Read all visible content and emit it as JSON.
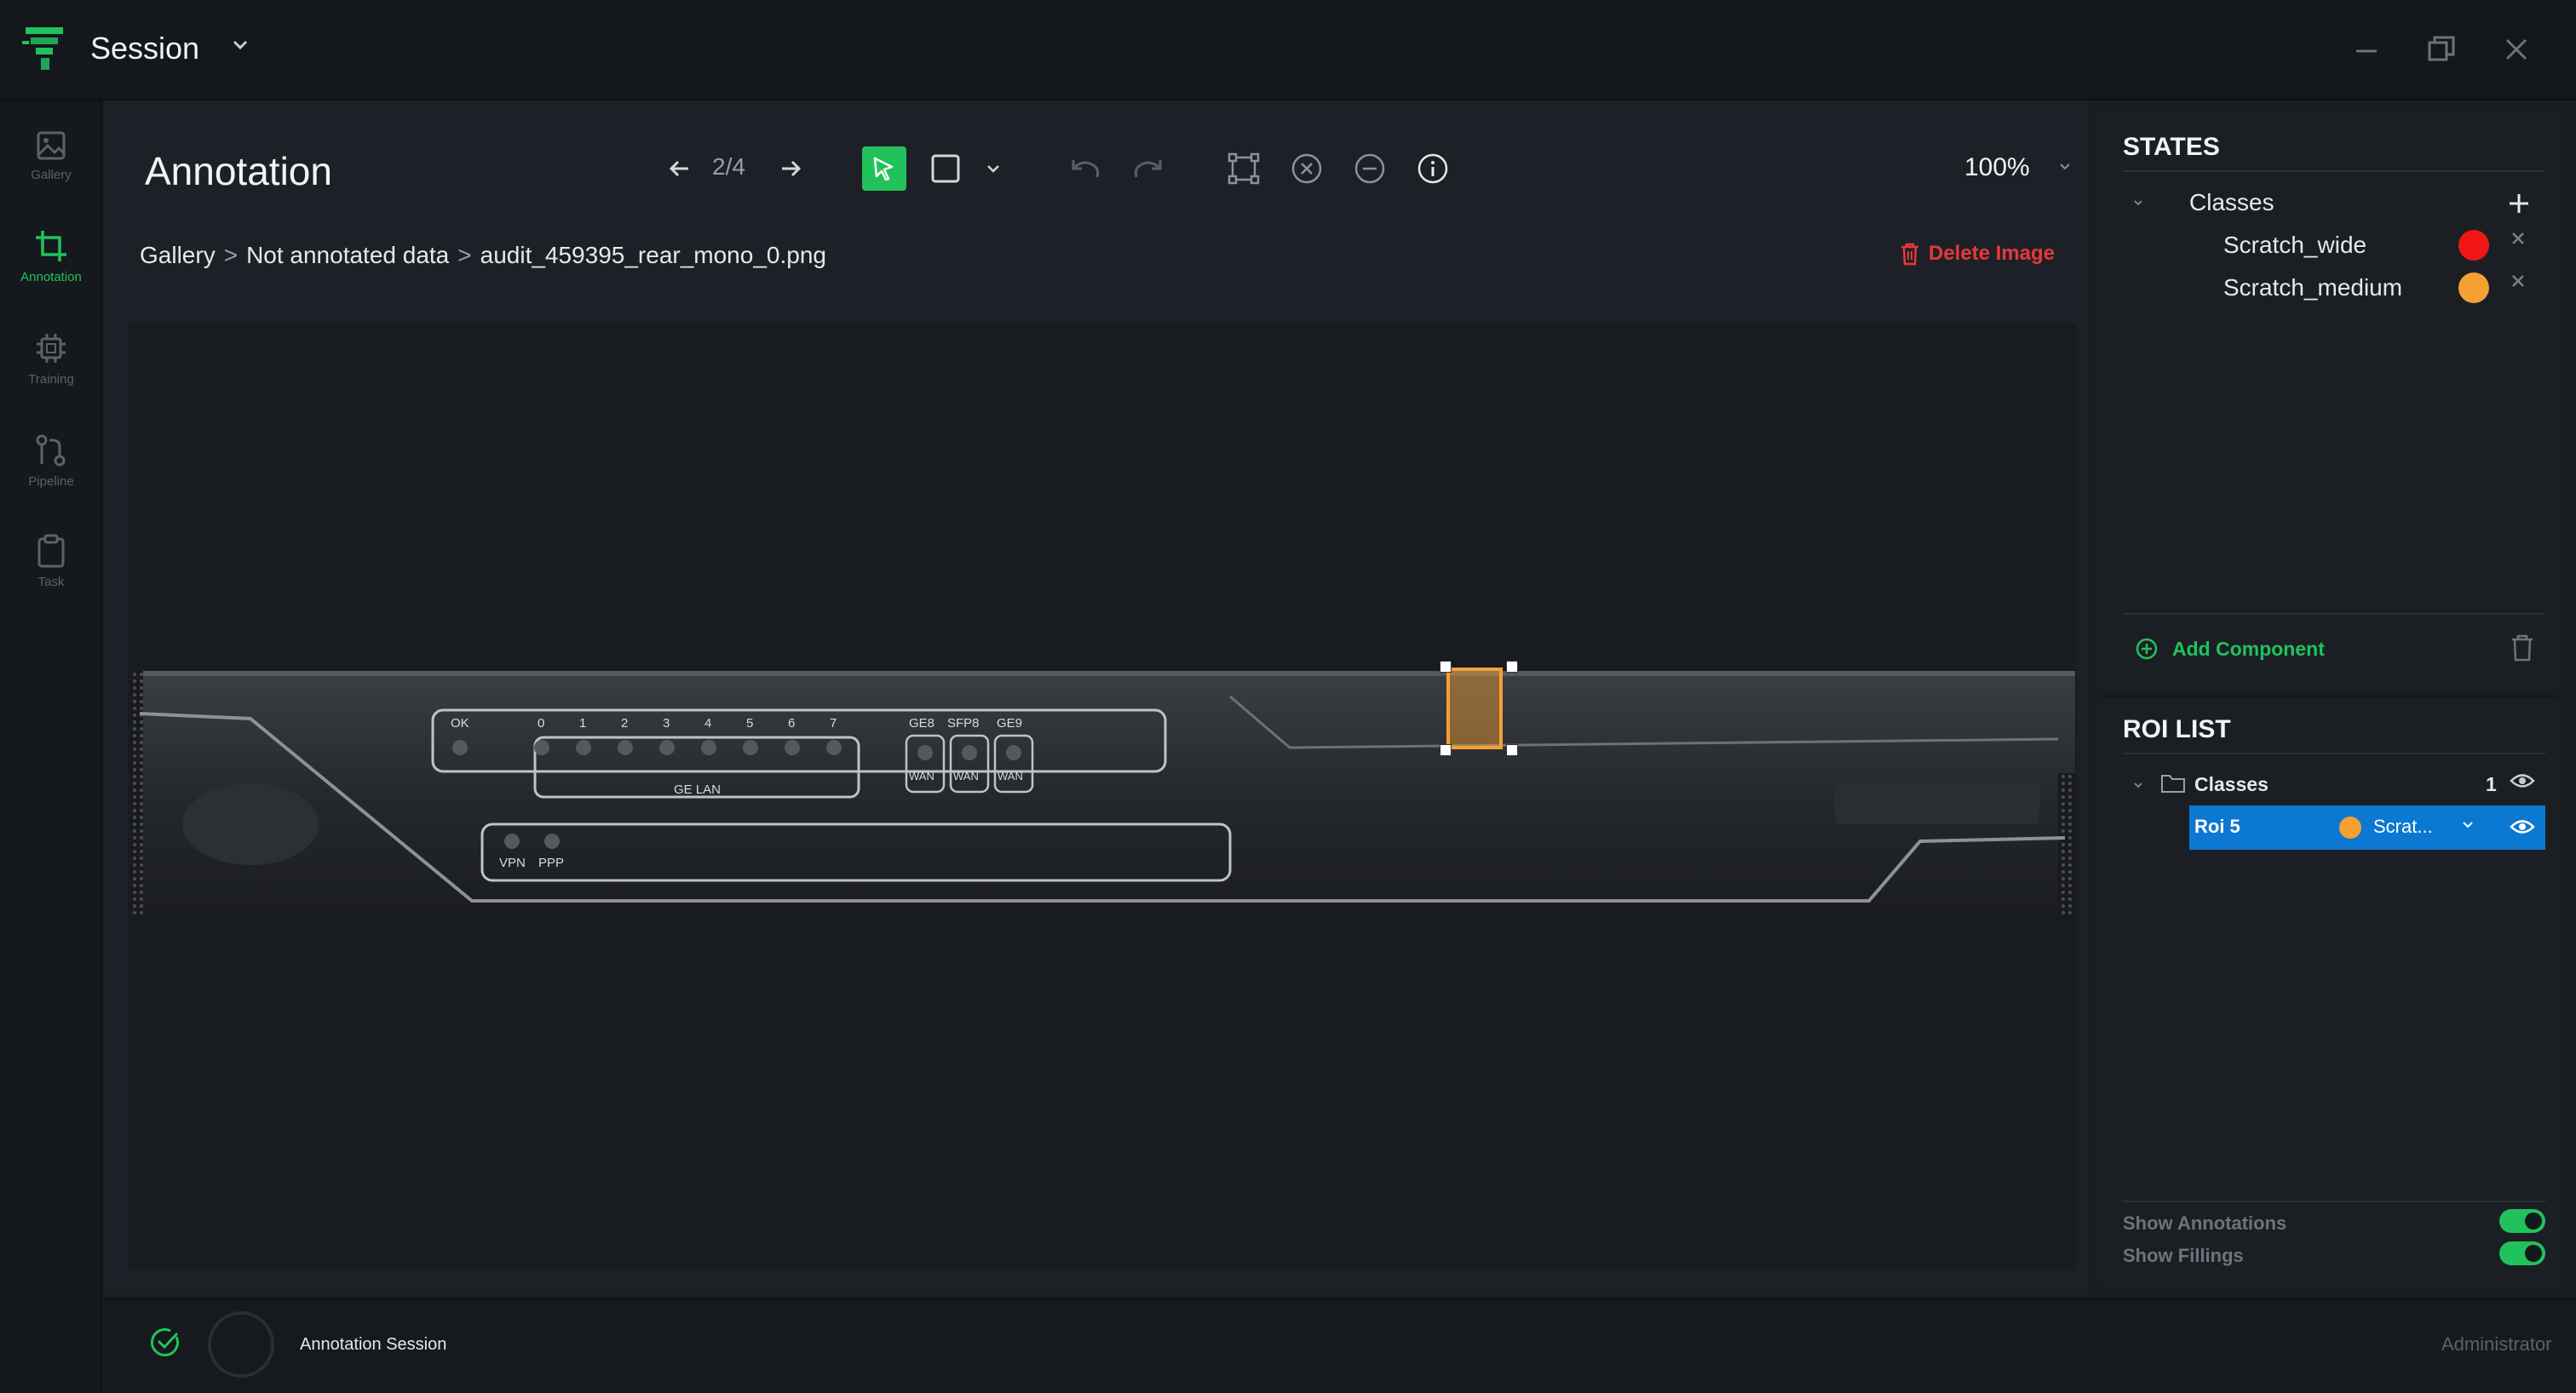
{
  "window": {
    "title": "Session"
  },
  "nav": {
    "items": [
      {
        "label": "Gallery"
      },
      {
        "label": "Annotation"
      },
      {
        "label": "Training"
      },
      {
        "label": "Pipeline"
      },
      {
        "label": "Task"
      }
    ]
  },
  "toolbar": {
    "page_title": "Annotation",
    "pager": "2/4",
    "zoom": "100%"
  },
  "breadcrumb": {
    "items": [
      "Gallery",
      "Not annotated data",
      "audit_459395_rear_mono_0.png"
    ],
    "separator": ">"
  },
  "actions": {
    "delete_image": "Delete Image"
  },
  "device_labels": {
    "ok": "OK",
    "ports": [
      "0",
      "1",
      "2",
      "3",
      "4",
      "5",
      "6",
      "7"
    ],
    "ge_lan": "GE LAN",
    "wan_ports": [
      "GE8",
      "SFP8",
      "GE9"
    ],
    "wan": "WAN",
    "vpn": "VPN",
    "ppp": "PPP"
  },
  "states": {
    "title": "STATES",
    "group": "Classes",
    "classes": [
      {
        "name": "Scratch_wide",
        "color": "#f01616"
      },
      {
        "name": "Scratch_medium",
        "color": "#f5a033"
      }
    ],
    "add_component": "Add Component"
  },
  "roi_list": {
    "title": "ROI LIST",
    "group": "Classes",
    "count": "1",
    "items": [
      {
        "name": "Roi 5",
        "class": "Scrat...",
        "color": "#f5a033"
      }
    ]
  },
  "toggles": {
    "show_annotations": "Show Annotations",
    "show_fillings": "Show Fillings",
    "show_annotations_on": true,
    "show_fillings_on": true
  },
  "status": {
    "label": "Annotation Session",
    "user": "Administrator"
  },
  "colors": {
    "accent": "#21c25c",
    "danger": "#e5383b",
    "selection": "#0b78d1",
    "roi_box": "#f5a033"
  }
}
